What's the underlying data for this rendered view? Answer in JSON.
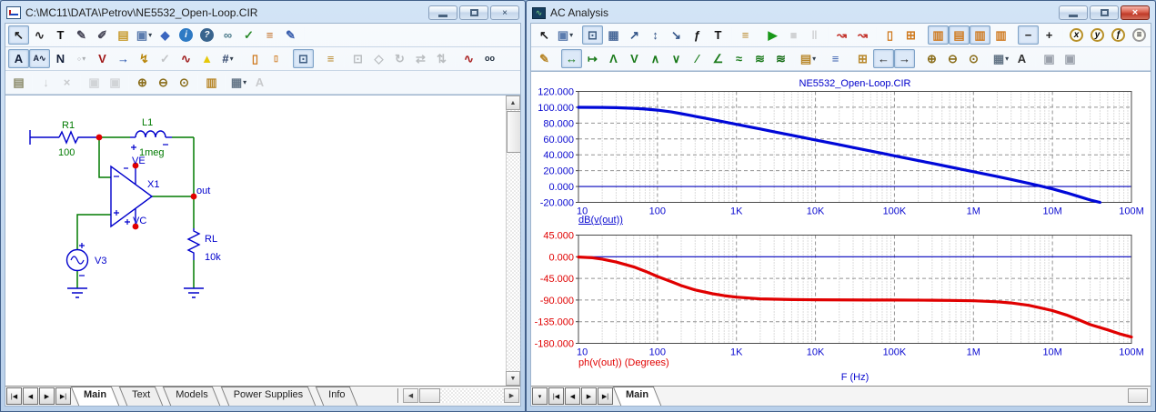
{
  "left_window": {
    "title": "C:\\MC11\\DATA\\Petrov\\NE5532_Open-Loop.CIR",
    "toolbar_main": [
      {
        "n": "select-tool",
        "g": "↖",
        "c": "#1c1c1c",
        "p": true
      },
      {
        "n": "wire-mode-tool",
        "g": "∿",
        "c": "#2a2a2a"
      },
      {
        "n": "text-tool",
        "g": "T",
        "c": "#111111"
      },
      {
        "n": "graphics-line-tool",
        "g": "✎",
        "c": "#444455"
      },
      {
        "n": "point-to-point-tool",
        "g": "✐",
        "c": "#444455"
      },
      {
        "n": "bus-tool",
        "g": "▤",
        "c": "#c79a2d"
      },
      {
        "n": "component-select-tool",
        "g": "▣",
        "c": "#5b7cae",
        "dd": true
      },
      {
        "n": "flag-tool",
        "g": "◆",
        "c": "#3a66c0"
      },
      {
        "n": "info-icon-tool",
        "g": "i",
        "circle": "#2e7ac4",
        "c": "#ffffff",
        "fillc": "#2e7ac4"
      },
      {
        "n": "help-tool",
        "g": "?",
        "circle": "#39648e",
        "c": "#ffffff",
        "fillc": "#39648e"
      },
      {
        "n": "link-tool",
        "g": "∞",
        "c": "#4a7a8a"
      },
      {
        "n": "checklist-tool",
        "g": "✓",
        "c": "#2a8a2a"
      },
      {
        "n": "border-rows-tool",
        "g": "≡",
        "c": "#c06a20"
      },
      {
        "n": "annotate-sheet-tool",
        "g": "✎",
        "c": "#3a5fae"
      },
      {
        "sep": true
      }
    ],
    "toolbar_mode": [
      {
        "n": "attribute-text-toggle",
        "g": "A",
        "c": "#15203a",
        "p": true
      },
      {
        "n": "wire-text-toggle",
        "g": "A∿",
        "c": "#15203a",
        "p": true,
        "small": true
      },
      {
        "n": "node-numbers-toggle",
        "g": "N",
        "c": "#15203a"
      },
      {
        "n": "node-voltages-toggle",
        "g": "◦",
        "c": "#666666",
        "d": true,
        "dd": true
      },
      {
        "n": "voltage-display-toggle",
        "g": "V",
        "c": "#a01818"
      },
      {
        "n": "current-display-toggle",
        "g": "→",
        "c": "#1a4aa8"
      },
      {
        "n": "power-display-toggle",
        "g": "↯",
        "c": "#b8860b"
      },
      {
        "n": "condition-display-toggle",
        "g": "✓",
        "c": "#777777",
        "d": true
      },
      {
        "n": "pin-connections-toggle",
        "g": "∿",
        "c": "#a02020"
      },
      {
        "n": "slope-warning-toggle",
        "g": "▲",
        "c": "#e6c80a"
      },
      {
        "n": "grid-toggle",
        "g": "#",
        "c": "#2a3f66",
        "dd": true
      },
      {
        "sep": true
      },
      {
        "n": "border-display-toggle",
        "g": "▯",
        "c": "#cf7a1f"
      },
      {
        "n": "title-block-toggle",
        "g": "▯",
        "c": "#cf7a1f",
        "small": true
      },
      {
        "sep": true
      },
      {
        "n": "select-border-mode",
        "g": "⊡",
        "c": "#3f5d82",
        "p": true
      },
      {
        "sep": true
      },
      {
        "n": "attributes-dialog-tool",
        "g": "≡",
        "c": "#b8872a"
      },
      {
        "sep": true
      },
      {
        "n": "box-select-tool",
        "g": "⊡",
        "c": "#556677",
        "d": true
      },
      {
        "n": "polygon-tool",
        "g": "◇",
        "c": "#556677",
        "d": true
      },
      {
        "n": "rotate-tool",
        "g": "↻",
        "c": "#556677",
        "d": true
      },
      {
        "n": "flip-horizontal-tool",
        "g": "⇄",
        "c": "#556677",
        "d": true
      },
      {
        "n": "flip-vertical-tool",
        "g": "⇅",
        "c": "#556677",
        "d": true
      },
      {
        "sep": true
      },
      {
        "n": "find-waveform-tool",
        "g": "∿",
        "c": "#aa2222"
      },
      {
        "n": "search-tool",
        "g": "oo",
        "c": "#1c2a3a",
        "small": true
      }
    ],
    "toolbar_view": [
      {
        "n": "info-page-button",
        "g": "▤",
        "c": "#8a8a6a"
      },
      {
        "sep": true
      },
      {
        "n": "step-down-button",
        "g": "↓",
        "c": "#888888",
        "d": true
      },
      {
        "n": "close-item-button",
        "g": "×",
        "c": "#888888",
        "d": true
      },
      {
        "sep": true
      },
      {
        "n": "bring-to-front-button",
        "g": "▣",
        "c": "#9aa0aa",
        "d": true
      },
      {
        "n": "send-to-back-button",
        "g": "▣",
        "c": "#9aa0aa",
        "d": true
      },
      {
        "sep": true
      },
      {
        "n": "zoom-in-button",
        "g": "⊕",
        "c": "#8a6d1a"
      },
      {
        "n": "zoom-out-button",
        "g": "⊖",
        "c": "#8a6d1a"
      },
      {
        "n": "zoom-scale-button",
        "g": "⊙",
        "c": "#8a6d1a"
      },
      {
        "sep": true
      },
      {
        "n": "page-view-button",
        "g": "▥",
        "c": "#b8872a"
      },
      {
        "sep": true
      },
      {
        "n": "tile-windows-button",
        "g": "▦",
        "c": "#667788",
        "dd": true
      },
      {
        "n": "font-button",
        "g": "A",
        "c": "#888888",
        "d": true
      }
    ],
    "schematic": {
      "parts": {
        "r1": {
          "name": "R1",
          "value": "100"
        },
        "l1": {
          "name": "L1",
          "value": "1meg"
        },
        "opamp": {
          "name": "X1"
        },
        "rl": {
          "name": "RL",
          "value": "10k"
        },
        "v3": {
          "name": "V3"
        }
      },
      "nodes": {
        "ve": "VE",
        "vc": "VC",
        "out": "out"
      },
      "colors": {
        "wire": "#007a00",
        "component": "#0000cc",
        "green_label": "#007a00",
        "blue_label": "#0000cc",
        "node_dot": "#e00000"
      }
    },
    "tabs": {
      "items": [
        "Main",
        "Text",
        "Models",
        "Power Supplies",
        "Info"
      ],
      "active": "Main"
    },
    "nav_buttons": [
      "|◀",
      "◀",
      "▶",
      "▶|"
    ]
  },
  "right_window": {
    "title": "AC Analysis",
    "toolbar_main": [
      {
        "n": "select-tool",
        "g": "↖",
        "c": "#1c1c1c"
      },
      {
        "n": "component-menu-button",
        "g": "▣",
        "c": "#5b7cae",
        "dd": true
      },
      {
        "sep": true
      },
      {
        "n": "scale-mode-button",
        "g": "⊡",
        "c": "#3f5d82",
        "p": true
      },
      {
        "n": "graph-pan-button",
        "g": "▦",
        "c": "#4a6a9a"
      },
      {
        "n": "zoom-diagonal-button",
        "g": "↗",
        "c": "#335588"
      },
      {
        "n": "zoom-vertical-button",
        "g": "↕",
        "c": "#335588"
      },
      {
        "n": "zoom-corner-button",
        "g": "↘",
        "c": "#335588"
      },
      {
        "n": "fx-scale-button",
        "g": "ƒ",
        "c": "#111111"
      },
      {
        "n": "text-button",
        "g": "T",
        "c": "#111111"
      },
      {
        "sep": true
      },
      {
        "n": "properties-button",
        "g": "≡",
        "c": "#b8872a"
      },
      {
        "sep": true
      },
      {
        "n": "run-button",
        "g": "▶",
        "c": "#189818"
      },
      {
        "n": "stop-button",
        "g": "■",
        "c": "#999999",
        "d": true
      },
      {
        "n": "pause-button",
        "g": "‖",
        "c": "#999999",
        "d": true
      },
      {
        "sep": true
      },
      {
        "n": "data-points-button",
        "g": "↝",
        "c": "#c23028"
      },
      {
        "n": "curve-step-button",
        "g": "↝",
        "c": "#c23028"
      },
      {
        "sep": true
      },
      {
        "n": "ruler-box-button",
        "g": "▯",
        "c": "#cf7a1f"
      },
      {
        "n": "data-labels-button",
        "g": "⊞",
        "c": "#cf7a1f"
      },
      {
        "sep": true
      },
      {
        "n": "panel-stripe-left-button",
        "g": "▥",
        "c": "#cf7a1f",
        "p": true
      },
      {
        "n": "panel-stripe-horizontal-button",
        "g": "▤",
        "c": "#cf7a1f",
        "p": true
      },
      {
        "n": "panel-stripe-center-button",
        "g": "▥",
        "c": "#cf7a1f",
        "p": true
      },
      {
        "n": "panel-stripe-plain-button",
        "g": "▥",
        "c": "#cf7a1f"
      },
      {
        "sep": true
      },
      {
        "n": "horizontal-cursor-button",
        "g": "−",
        "c": "#222222",
        "p": true
      },
      {
        "n": "crosshair-cursor-button",
        "g": "+",
        "c": "#222222"
      },
      {
        "sep": true
      },
      {
        "n": "x-axis-settings-button",
        "g": "x",
        "circle": "#b8912a"
      },
      {
        "n": "y-axis-settings-button",
        "g": "y",
        "circle": "#b8912a"
      },
      {
        "n": "fx-settings-button",
        "g": "ƒ",
        "circle": "#b8912a"
      },
      {
        "n": "zoom-text-button",
        "g": "≡",
        "circle": "#9a9a9a"
      }
    ],
    "toolbar_cursor": [
      {
        "n": "edit-button",
        "g": "✎",
        "c": "#b8872a"
      },
      {
        "sep": true
      },
      {
        "n": "cursor-mode-button",
        "g": "↔",
        "c": "#1a7a1a",
        "p": true
      },
      {
        "n": "next-point-button",
        "g": "↦",
        "c": "#1a7a1a"
      },
      {
        "n": "peak-button",
        "g": "Λ",
        "c": "#1a7a1a"
      },
      {
        "n": "valley-button",
        "g": "V",
        "c": "#1a7a1a"
      },
      {
        "n": "high-button",
        "g": "∧",
        "c": "#1a7a1a"
      },
      {
        "n": "low-button",
        "g": "∨",
        "c": "#1a7a1a"
      },
      {
        "n": "slope-button",
        "g": "⁄",
        "c": "#1a7a1a"
      },
      {
        "n": "inflection-button",
        "g": "∠",
        "c": "#1a7a1a"
      },
      {
        "n": "global-high-button",
        "g": "≈",
        "c": "#1a7a1a"
      },
      {
        "n": "global-low-button",
        "g": "≋",
        "c": "#1a7a1a"
      },
      {
        "n": "top-bottom-button",
        "g": "≋",
        "c": "#116a11"
      },
      {
        "sep": true
      },
      {
        "n": "copy-graph-button",
        "g": "▤",
        "c": "#b8872a",
        "dd": true
      },
      {
        "sep": true
      },
      {
        "n": "numeric-output-button",
        "g": "≡",
        "c": "#3a5fae"
      },
      {
        "sep": true
      },
      {
        "n": "state-variables-button",
        "g": "⊞",
        "c": "#b8872a"
      },
      {
        "n": "cursor-left-button",
        "g": "←",
        "c": "#222222",
        "p": true
      },
      {
        "n": "cursor-right-button",
        "g": "→",
        "c": "#222222",
        "p": true
      },
      {
        "sep": true
      },
      {
        "n": "zoom-in-button",
        "g": "⊕",
        "c": "#8a6d1a"
      },
      {
        "n": "zoom-out-button",
        "g": "⊖",
        "c": "#8a6d1a"
      },
      {
        "n": "zoom-scale-button",
        "g": "⊙",
        "c": "#8a6d1a"
      },
      {
        "sep": true
      },
      {
        "n": "tile-button",
        "g": "▦",
        "c": "#667788",
        "dd": true
      },
      {
        "n": "font-button",
        "g": "A",
        "c": "#333333"
      },
      {
        "sep": true
      },
      {
        "n": "bring-front-button",
        "g": "▣",
        "c": "#9aa0aa"
      },
      {
        "n": "send-back-button",
        "g": "▣",
        "c": "#9aa0aa"
      }
    ],
    "tabs": {
      "items": [
        "Main"
      ],
      "active": "Main"
    },
    "nav_buttons": [
      "▾",
      "|◀",
      "◀",
      "▶",
      "▶|"
    ]
  },
  "chart_data": [
    {
      "type": "line",
      "name": "gain",
      "title": "NE5532_Open-Loop.CIR",
      "x_scale": "log",
      "x_range": [
        10,
        100000000
      ],
      "x_tick_labels": [
        "10",
        "100",
        "1K",
        "10K",
        "100K",
        "1M",
        "10M",
        "100M"
      ],
      "y_ticks": [
        120,
        100,
        80,
        60,
        40,
        20,
        0,
        -20
      ],
      "y_range": [
        -20,
        120
      ],
      "curve_label": "dB(v(out))",
      "y_label_color": "#0a0ad0",
      "x_label_color": "#0a0ad0",
      "zero_line": true,
      "grid": true,
      "series": [
        {
          "name": "dB(v(out))",
          "color": "#0008d8",
          "points": [
            [
              10,
              99.9
            ],
            [
              20,
              99.8
            ],
            [
              30,
              99.5
            ],
            [
              50,
              98.7
            ],
            [
              70,
              97.7
            ],
            [
              100,
              96.4
            ],
            [
              150,
              94.1
            ],
            [
              200,
              91.9
            ],
            [
              300,
              88.5
            ],
            [
              500,
              84.3
            ],
            [
              700,
              81.5
            ],
            [
              1000,
              78.5
            ],
            [
              2000,
              72.6
            ],
            [
              3000,
              69.1
            ],
            [
              5000,
              64.7
            ],
            [
              7000,
              61.8
            ],
            [
              10000,
              58.7
            ],
            [
              20000,
              52.7
            ],
            [
              30000,
              49.2
            ],
            [
              50000,
              44.7
            ],
            [
              70000,
              41.8
            ],
            [
              100000,
              38.7
            ],
            [
              200000,
              32.7
            ],
            [
              300000,
              29.2
            ],
            [
              500000,
              24.7
            ],
            [
              700000,
              21.8
            ],
            [
              1000000,
              18.7
            ],
            [
              2000000,
              12.6
            ],
            [
              3000000,
              8.9
            ],
            [
              5000000,
              4.0
            ],
            [
              7000000,
              0.8
            ],
            [
              10000000,
              -3.0
            ],
            [
              15000000,
              -7.8
            ],
            [
              20000000,
              -11.6
            ],
            [
              30000000,
              -17.0
            ],
            [
              40000000,
              -20.0
            ]
          ]
        }
      ]
    },
    {
      "type": "line",
      "name": "phase",
      "x_scale": "log",
      "x_range": [
        10,
        100000000
      ],
      "x_tick_labels": [
        "10",
        "100",
        "1K",
        "10K",
        "100K",
        "1M",
        "10M",
        "100M"
      ],
      "y_ticks": [
        45,
        0,
        -45,
        -90,
        -135,
        -180
      ],
      "y_range": [
        -180,
        45
      ],
      "curve_label": "ph(v(out)) (Degrees)",
      "x_axis_label": "F (Hz)",
      "y_label_color": "#e00000",
      "x_label_color": "#0a0ad0",
      "zero_line": true,
      "grid": true,
      "series": [
        {
          "name": "ph(v(out)) (Degrees)",
          "color": "#e00000",
          "points": [
            [
              10,
              -0.5
            ],
            [
              15,
              -2
            ],
            [
              20,
              -5
            ],
            [
              30,
              -11
            ],
            [
              50,
              -21
            ],
            [
              70,
              -30
            ],
            [
              100,
              -41
            ],
            [
              150,
              -52
            ],
            [
              200,
              -60
            ],
            [
              300,
              -69
            ],
            [
              500,
              -77
            ],
            [
              700,
              -81
            ],
            [
              1000,
              -84
            ],
            [
              2000,
              -87.5
            ],
            [
              5000,
              -89
            ],
            [
              10000,
              -89.5
            ],
            [
              50000,
              -90
            ],
            [
              100000,
              -90
            ],
            [
              300000,
              -90.3
            ],
            [
              500000,
              -90.7
            ],
            [
              1000000,
              -91.5
            ],
            [
              2000000,
              -93.5
            ],
            [
              3000000,
              -96
            ],
            [
              5000000,
              -101
            ],
            [
              7000000,
              -106
            ],
            [
              10000000,
              -112
            ],
            [
              15000000,
              -121
            ],
            [
              20000000,
              -129
            ],
            [
              30000000,
              -141
            ],
            [
              50000000,
              -152
            ],
            [
              70000000,
              -160
            ],
            [
              100000000,
              -167
            ]
          ]
        }
      ]
    }
  ]
}
